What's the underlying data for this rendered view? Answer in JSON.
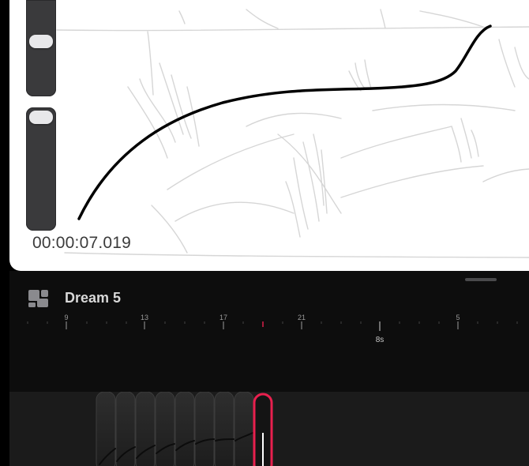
{
  "canvas": {
    "time_readout": "00:00:07.019"
  },
  "panel": {
    "title": "Dream 5",
    "ruler_labels": [
      "9",
      "13",
      "17",
      "21",
      "5"
    ],
    "playhead_label": "8s"
  },
  "colors": {
    "accent": "#e8204e",
    "stroke": "#000000",
    "sketch": "#d6d6d6",
    "panel_bg": "#0d0d0d",
    "track_bg": "#1b1b1b"
  }
}
